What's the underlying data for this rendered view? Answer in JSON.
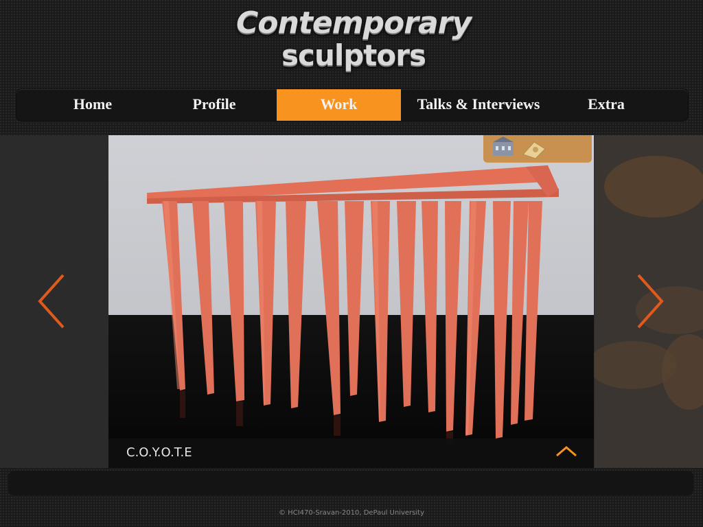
{
  "logo": {
    "line1": "Contemporary",
    "line2": "sculptors"
  },
  "nav": {
    "items": [
      {
        "label": "Home"
      },
      {
        "label": "Profile"
      },
      {
        "label": "Work"
      },
      {
        "label": "Talks & Interviews"
      },
      {
        "label": "Extra"
      }
    ],
    "active": "Work"
  },
  "gallery": {
    "caption": "C.O.Y.O.T.E",
    "prev_icon": "chevron-left-icon",
    "next_icon": "chevron-right-icon",
    "toggle_icon": "chevron-up-icon"
  },
  "footer": {
    "text": "© HCI470-Sravan-2010, DePaul University"
  },
  "colors": {
    "accent": "#f7931e",
    "arrow": "#e05a1e",
    "sculpture": "#e0705a"
  }
}
